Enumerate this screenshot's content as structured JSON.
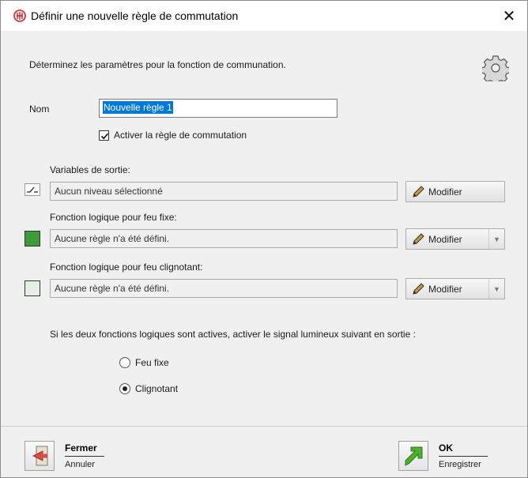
{
  "window": {
    "title": "Définir une nouvelle règle de commutation",
    "close_glyph": "✕"
  },
  "header": {
    "description": "Déterminez les paramètres pour la fonction de communation."
  },
  "form": {
    "nom_label": "Nom",
    "nom_value": "Nouvelle règle 1",
    "activate_label": "Activer la règle de commutation",
    "activate_checked": true
  },
  "sections": [
    {
      "label": "Variables de sortie:",
      "value": "Aucun niveau sélectionné",
      "button": "Modifier",
      "has_dropdown": false,
      "icon": "switch-icon"
    },
    {
      "label": "Fonction logique pour feu fixe:",
      "value": "Aucune règle n'a été défini.",
      "button": "Modifier",
      "has_dropdown": true,
      "swatch_color": "#3f9a3a"
    },
    {
      "label": "Fonction logique pour feu clignotant:",
      "value": "Aucune règle n'a été défini.",
      "button": "Modifier",
      "has_dropdown": true,
      "swatch_color": "#e6efe4"
    }
  ],
  "signal": {
    "question": "Si les deux fonctions logiques sont actives, activer le signal lumineux suivant en sortie :",
    "options": [
      {
        "label": "Feu fixe",
        "selected": false
      },
      {
        "label": "Clignotant",
        "selected": true
      }
    ]
  },
  "footer": {
    "close": {
      "title": "Fermer",
      "sub": "Annuler"
    },
    "ok": {
      "title": "OK",
      "sub": "Enregistrer"
    }
  },
  "colors": {
    "accent_selection": "#0078d7",
    "ok_arrow": "#4caf2e",
    "close_arrow": "#d94a4a"
  }
}
